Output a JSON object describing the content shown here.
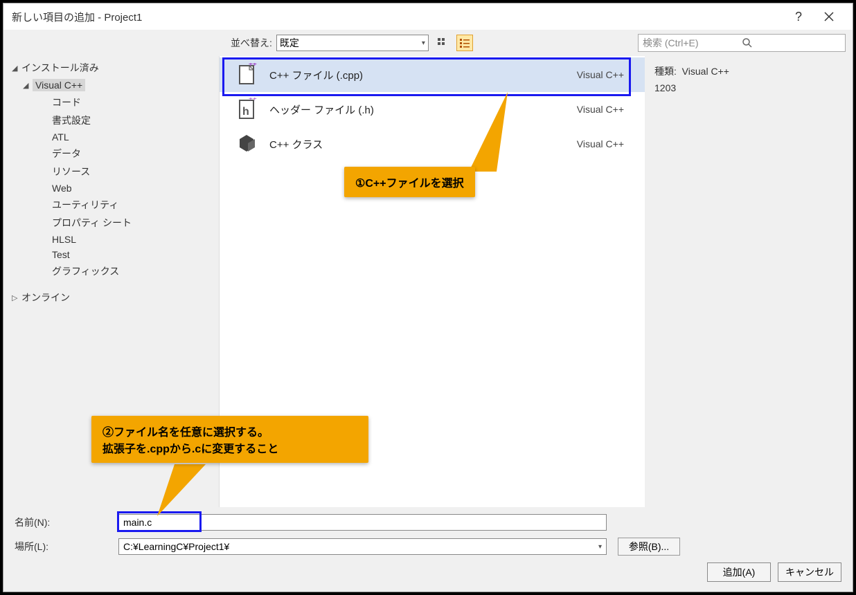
{
  "title": "新しい項目の追加 - Project1",
  "sidebar": {
    "installed": "インストール済み",
    "vcpp": "Visual C++",
    "items": [
      "コード",
      "書式設定",
      "ATL",
      "データ",
      "リソース",
      "Web",
      "ユーティリティ",
      "プロパティ シート",
      "HLSL",
      "Test",
      "グラフィックス"
    ],
    "online": "オンライン"
  },
  "toolbar": {
    "sort_label": "並べ替え:",
    "sort_value": "既定",
    "search_placeholder": "検索 (Ctrl+E)"
  },
  "templates": [
    {
      "label": "C++ ファイル (.cpp)",
      "lang": "Visual C++"
    },
    {
      "label": "ヘッダー ファイル (.h)",
      "lang": "Visual C++"
    },
    {
      "label": "C++ クラス",
      "lang": "Visual C++"
    }
  ],
  "details": {
    "type_label": "種類:",
    "type_value": "Visual C++",
    "line2": "1203"
  },
  "form": {
    "name_label": "名前(N):",
    "name_value": "main.c",
    "location_label": "場所(L):",
    "location_value": "C:¥LearningC¥Project1¥",
    "browse": "参照(B)...",
    "add": "追加(A)",
    "cancel": "キャンセル"
  },
  "callouts": {
    "c1": "①C++ファイルを選択",
    "c2a": "②ファイル名を任意に選択する。",
    "c2b": "拡張子を.cppから.cに変更すること"
  }
}
